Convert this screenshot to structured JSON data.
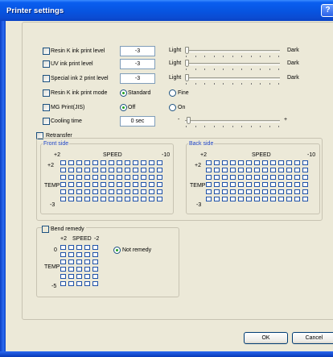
{
  "window": {
    "title": "Printer settings",
    "help_label": "?"
  },
  "settings": {
    "resin_k_level": {
      "label": "Resin K ink print level",
      "value": "-3",
      "min_label": "Light",
      "max_label": "Dark"
    },
    "uv_level": {
      "label": "UV ink print level",
      "value": "-3",
      "min_label": "Light",
      "max_label": "Dark"
    },
    "special2_level": {
      "label": "Special ink 2 print level",
      "value": "-3",
      "min_label": "Light",
      "max_label": "Dark"
    },
    "resin_k_mode": {
      "label": "Resin K ink print mode",
      "options": [
        "Standard",
        "Fine"
      ],
      "selected": "Standard"
    },
    "mg_print": {
      "label": "MG Print(JIS)",
      "options": [
        "Off",
        "On"
      ],
      "selected": "Off"
    },
    "cooling_time": {
      "label": "Cooling time",
      "value": "0 sec",
      "min_label": "-",
      "max_label": "+"
    }
  },
  "retransfer": {
    "label": "Retransfer",
    "front": {
      "title": "Front side",
      "speed_label": "SPEED",
      "speed_min": "+2",
      "speed_max": "-10",
      "temp_label": "TEMP",
      "temp_max": "+2",
      "temp_min": "-3"
    },
    "back": {
      "title": "Back side",
      "speed_label": "SPEED",
      "speed_min": "+2",
      "speed_max": "-10",
      "temp_label": "TEMP",
      "temp_max": "+2",
      "temp_min": "-3"
    }
  },
  "bend_remedy": {
    "label": "Bend remedy",
    "speed_label": "SPEED",
    "speed_min": "+2",
    "speed_max": "-2",
    "temp_label": "TEMP",
    "temp_max": "0",
    "temp_min": "-5",
    "option_label": "Not remedy"
  },
  "buttons": {
    "ok": "OK",
    "cancel": "Cancel"
  }
}
